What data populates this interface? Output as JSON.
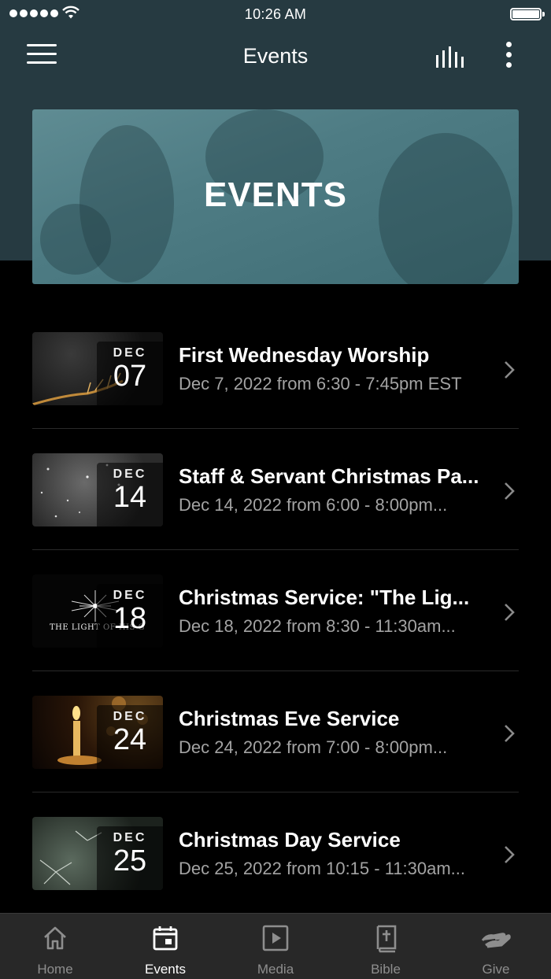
{
  "status_bar": {
    "time": "10:26 AM"
  },
  "nav": {
    "title": "Events"
  },
  "hero": {
    "title": "EVENTS"
  },
  "events": [
    {
      "month": "DEC",
      "day": "07",
      "title": "First Wednesday Worship",
      "subtitle": "Dec 7, 2022 from 6:30 - 7:45pm EST"
    },
    {
      "month": "DEC",
      "day": "14",
      "title": "Staff & Servant Christmas Pa...",
      "subtitle": "Dec 14, 2022 from 6:00 - 8:00pm..."
    },
    {
      "month": "DEC",
      "day": "18",
      "title": "Christmas Service: \"The Lig...",
      "subtitle": "Dec 18, 2022 from 8:30 - 11:30am...",
      "thumb_text": "THE LIGHT OF HIS G"
    },
    {
      "month": "DEC",
      "day": "24",
      "title": "Christmas Eve Service",
      "subtitle": "Dec 24, 2022 from 7:00 - 8:00pm..."
    },
    {
      "month": "DEC",
      "day": "25",
      "title": "Christmas Day Service",
      "subtitle": "Dec 25, 2022 from 10:15 - 11:30am..."
    }
  ],
  "tabs": [
    {
      "label": "Home",
      "icon": "home-icon"
    },
    {
      "label": "Events",
      "icon": "calendar-icon",
      "active": true
    },
    {
      "label": "Media",
      "icon": "play-icon"
    },
    {
      "label": "Bible",
      "icon": "bible-icon"
    },
    {
      "label": "Give",
      "icon": "give-icon"
    }
  ],
  "colors": {
    "header_bg": "#263a41",
    "hero_tint": "#4e7c84",
    "tab_bar_bg": "#282828"
  }
}
